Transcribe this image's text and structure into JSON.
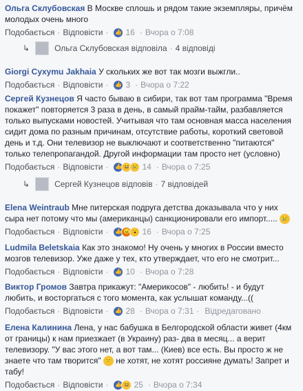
{
  "labels": {
    "like": "Подобається",
    "reply": "Відповісти",
    "edited": "Відредаговано"
  },
  "comments": [
    {
      "author": "Ольга Склубовская",
      "text1": "В Москве сплошь и рядом такие экземпляры, причём",
      "text2": "молодых очень много",
      "likes": "16",
      "time": "Вчора о 7:08"
    },
    {
      "reply_author": "Ольга Склубовская",
      "reply_text": "відповіла",
      "reply_count": "4 відповіді"
    },
    {
      "author": "Giorgi Cyxymu Jakhaia",
      "text1": "У скольких же вот так мозги выжгли..",
      "likes": "3",
      "time": "Вчора о 7:22"
    },
    {
      "author": "Сергей Кузнецов",
      "text1": "Я часто бываю в сибири, так вот там программа \"Время",
      "text2": "покажет\" повторяется 3 раза в день, в самый прайм-тайм, разбавляется",
      "text3": "только выпусками новостей. Учитывая что там основная масса населения",
      "text4": "сидит дома по разным причинам, отсутствие работы, короткий световой",
      "text5": "день и т.д. Они телевизор не выключают и соответственно \"питаются\"",
      "text6": "только телепропагандой. Другой информации там просто нет (условно)",
      "likes": "14",
      "time": "Вчора о 7:25"
    },
    {
      "reply_author": "Сергей Кузнецов",
      "reply_text": "відповів",
      "reply_count": "7 відповідей"
    },
    {
      "author": "Elena Weintraub",
      "text1": "Мне питерская подруга детства доказывала что у них",
      "text2": "сыра нет потому что мы (американцы) санкционировали его импорт.....",
      "likes": "16",
      "time": "Вчора о 7:25"
    },
    {
      "author": "Ludmila Beletskaia",
      "text1": "Как это знакомо! Ну очень у многих в России вместо",
      "text2": "мозгов телевизор. Уже даже у тех, кто утверждает, что его не смотрит...",
      "likes": "10",
      "time": "Вчора о 7:28"
    },
    {
      "author": "Виктор Громов",
      "text1": "Завтра прикажут: \"Америкосов\" - любить! - и будут",
      "text2": "любить, и восторгаться с того момента, как услышат команду...((",
      "likes": "28",
      "time": "Вчора о 7:31"
    },
    {
      "author": "Елена Калинина",
      "text1": "Лена, у нас бабушка в Белгородской области живет (4км",
      "text2": "от границы) к нам приезжает (в Украину) раз- два в месяц... а верит",
      "text3": "телевизору. \"У вас этого нет, а вот там... (Киев) все есть. Вы просто ж не",
      "text4": "знаете что там творится\"",
      "text4b": "не хотят, не хотят россияне думать! Запрет и",
      "text5": "табу!",
      "likes": "25",
      "time": "Вчора о 7:34"
    }
  ],
  "colors": {
    "author": "#365899",
    "meta": "#90949c",
    "background": "#f6f7f9",
    "like": "#4267b2"
  },
  "icons": [
    "reply-arrow-icon",
    "avatar-image",
    "like-reaction-icon",
    "haha-reaction-icon",
    "wow-reaction-icon",
    "sad-reaction-icon",
    "angry-reaction-icon",
    "confused-emoji-icon"
  ]
}
